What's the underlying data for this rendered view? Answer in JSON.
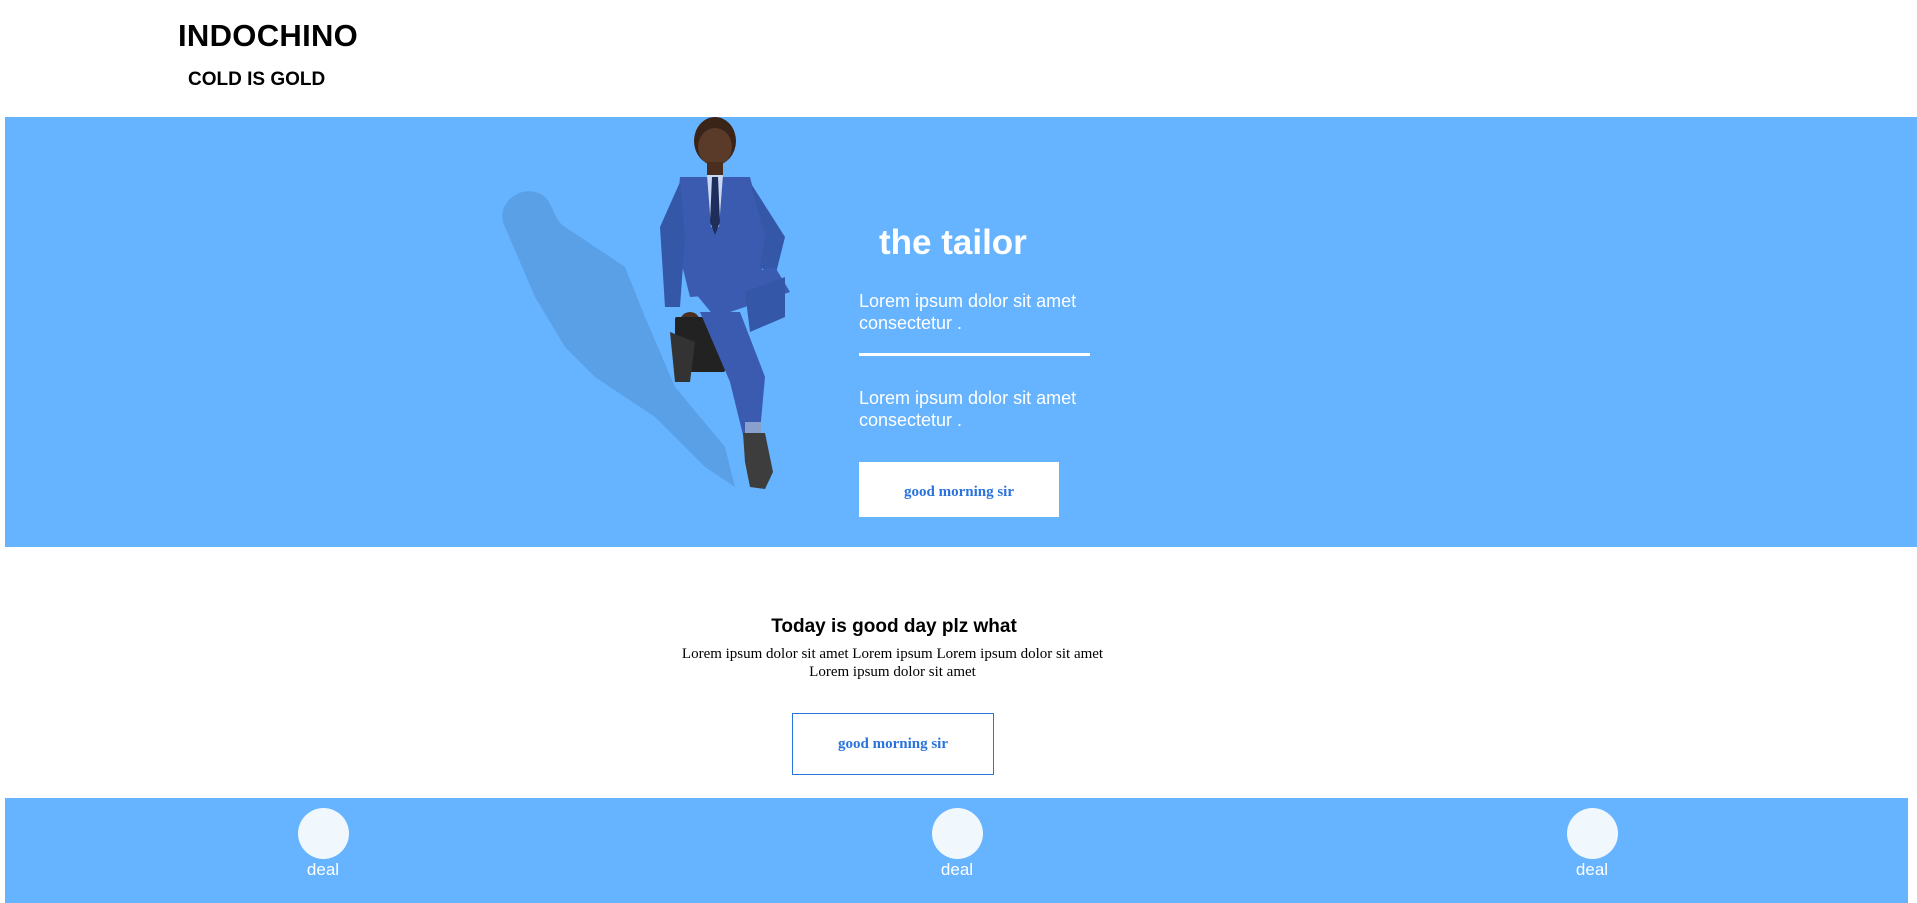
{
  "header": {
    "brand": "INDOCHINO",
    "tagline": "COLD IS GOLD"
  },
  "hero": {
    "title": "the tailor",
    "text_1": "Lorem ipsum dolor sit amet consectetur .",
    "text_2": "Lorem ipsum dolor sit amet consectetur .",
    "button_label": "good morning sir",
    "image_description": "man-in-blue-suit-icon",
    "background_color": "#66b3ff"
  },
  "promo": {
    "title": "Today is good day plz what",
    "text": "Lorem ipsum dolor sit amet Lorem ipsum Lorem ipsum dolor sit amet Lorem ipsum dolor sit amet",
    "button_label": "good morning sir",
    "accent_color": "#2a73dd"
  },
  "deals": {
    "items": [
      {
        "label": "deal",
        "icon": "circle-icon"
      },
      {
        "label": "deal",
        "icon": "circle-icon"
      },
      {
        "label": "deal",
        "icon": "circle-icon"
      }
    ]
  }
}
